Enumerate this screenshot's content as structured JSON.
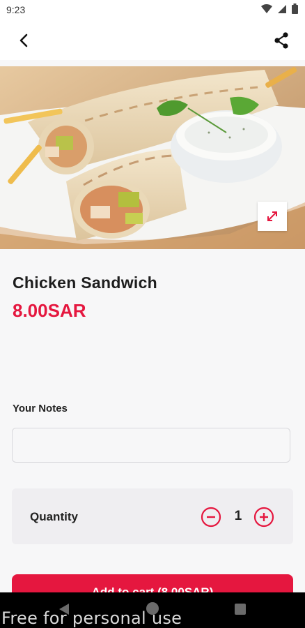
{
  "status_bar": {
    "time": "9:23"
  },
  "product": {
    "name": "Chicken Sandwich",
    "price": "8.00SAR"
  },
  "notes": {
    "label": "Your Notes",
    "value": ""
  },
  "quantity": {
    "label": "Quantity",
    "value": "1"
  },
  "cart_button": {
    "label": "Add to cart (8.00SAR)"
  },
  "watermark": "Free for personal use",
  "colors": {
    "accent": "#e5173f",
    "background": "#f7f7f8",
    "card": "#efeef1"
  }
}
